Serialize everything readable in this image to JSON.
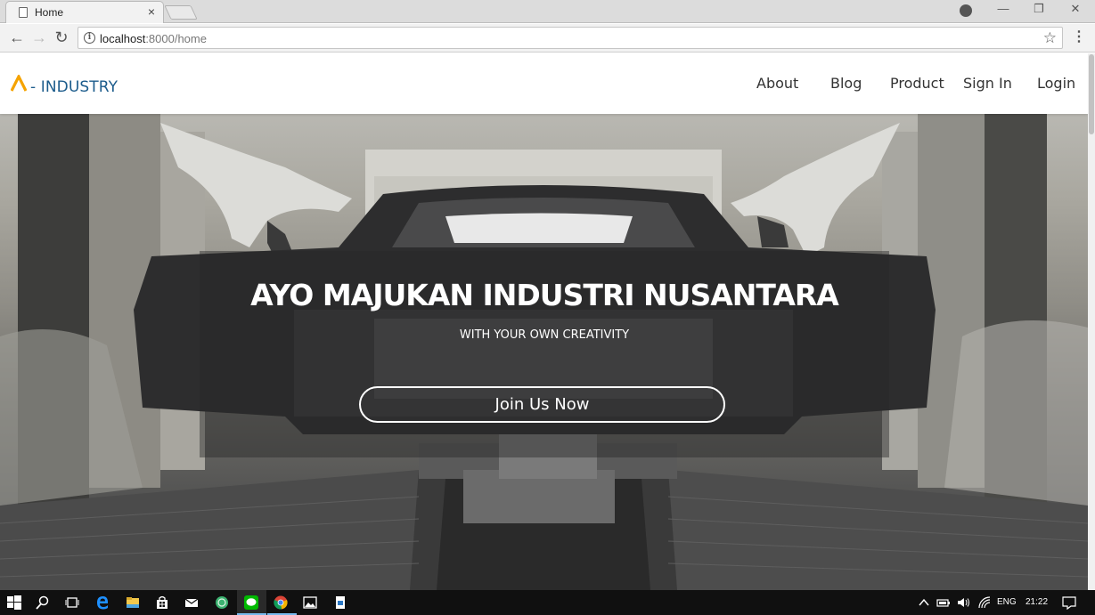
{
  "browser": {
    "tab_title": "Home",
    "tab_close": "×",
    "url_host": "localhost",
    "url_rest": ":8000/home",
    "back_icon": "←",
    "forward_icon": "→",
    "reload_icon": "↻",
    "star_icon": "☆",
    "menu_icon": "⋮",
    "minimize": "—",
    "restore": "❐",
    "close": "✕"
  },
  "site": {
    "logo_text": "- INDUSTRY",
    "logo_color": "#f5a300",
    "logo_text_color": "#1c5c8c",
    "nav": [
      "About",
      "Blog",
      "Product",
      "Sign In",
      "Login"
    ]
  },
  "hero": {
    "title": "AYO MAJUKAN INDUSTRI NUSANTARA",
    "subtitle": "WITH YOUR OWN CREATIVITY",
    "cta_label": "Join Us Now"
  },
  "taskbar": {
    "language": "ENG",
    "time": "21:22"
  }
}
